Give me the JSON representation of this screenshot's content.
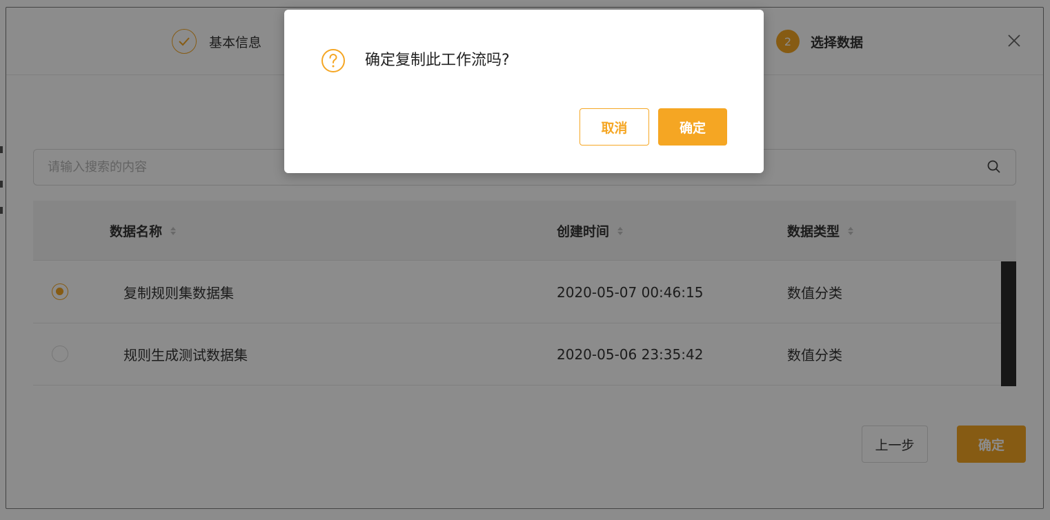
{
  "steps": [
    {
      "label": "基本信息",
      "state": "done"
    },
    {
      "number": "2",
      "label": "选择数据",
      "state": "active"
    }
  ],
  "search": {
    "placeholder": "请输入搜索的内容"
  },
  "table": {
    "columns": [
      "数据名称",
      "创建时间",
      "数据类型"
    ],
    "rows": [
      {
        "selected": true,
        "name": "复制规则集数据集",
        "created": "2020-05-07 00:46:15",
        "type": "数值分类"
      },
      {
        "selected": false,
        "name": "规则生成测试数据集",
        "created": "2020-05-06 23:35:42",
        "type": "数值分类"
      }
    ]
  },
  "footer": {
    "prev_label": "上一步",
    "confirm_label": "确定"
  },
  "dialog": {
    "message": "确定复制此工作流吗?",
    "cancel_label": "取消",
    "ok_label": "确定"
  },
  "colors": {
    "accent": "#f5a623",
    "overlay": "rgba(0,0,0,0.45)"
  },
  "icons": [
    "check-circle-icon",
    "close-icon",
    "search-icon",
    "sort-icon",
    "radio-icon",
    "question-circle-icon"
  ]
}
